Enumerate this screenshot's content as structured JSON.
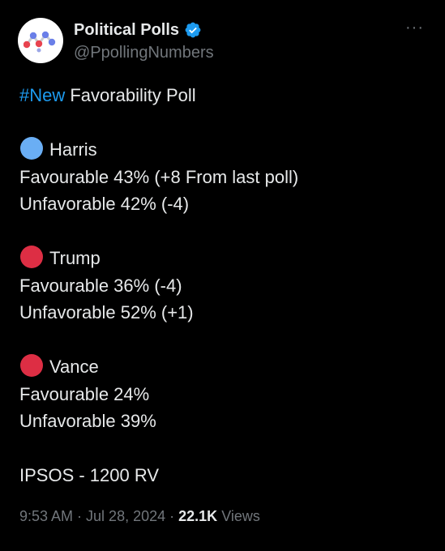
{
  "author": {
    "display_name": "Political Polls",
    "handle": "@PpollingNumbers",
    "verified": true
  },
  "more_glyph": "···",
  "post": {
    "hashtag": "#New",
    "headline_rest": " Favorability Poll",
    "sections": [
      {
        "candidate": "Harris",
        "dot_color": "#6aaef4",
        "favourable": "Favourable 43% (+8 From last poll)",
        "unfavorable": "Unfavorable 42% (-4)"
      },
      {
        "candidate": "Trump",
        "dot_color": "#dd2e44",
        "favourable": "Favourable 36% (-4)",
        "unfavorable": "Unfavorable 52% (+1)"
      },
      {
        "candidate": "Vance",
        "dot_color": "#dd2e44",
        "favourable": "Favourable 24%",
        "unfavorable": "Unfavorable 39%"
      }
    ],
    "source": "IPSOS - 1200 RV"
  },
  "meta": {
    "time": "9:53 AM",
    "date": "Jul 28, 2024",
    "views_count": "22.1K",
    "views_label": "Views",
    "separator": "·"
  },
  "colors": {
    "background": "#000000",
    "text": "#e7e9ea",
    "secondary": "#71767b",
    "link": "#1d9bf0",
    "verified_badge": "#1d9bf0",
    "harris_dot": "#6aaef4",
    "red_dot": "#dd2e44"
  }
}
